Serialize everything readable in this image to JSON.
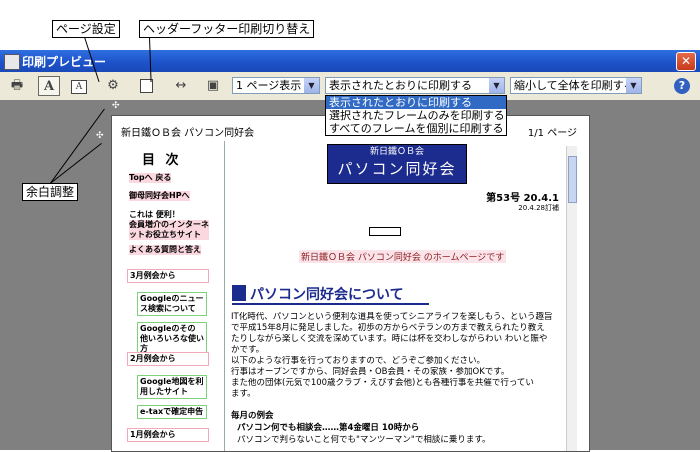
{
  "callouts": {
    "page_setup": "ページ設定",
    "header_footer_toggle": "ヘッダーフッター印刷切り替え",
    "margin_adjust": "余白調整"
  },
  "window": {
    "title": "印刷プレビュー",
    "close_glyph": "✕"
  },
  "toolbar": {
    "print_glyph": "🖶",
    "portrait_glyph": "A",
    "landscape_glyph": "A",
    "page_setup_glyph": "⚙",
    "width_glyph": "↔",
    "full_page_glyph": "▣",
    "page_view": "1 ページ表示",
    "frame_option": "表示されたとおりに印刷する",
    "shrink_option": "縮小して全体を印刷する",
    "help_glyph": "?",
    "dropdown_arrow": "▼"
  },
  "frame_options": [
    "表示されたとおりに印刷する",
    "選択されたフレームのみを印刷する",
    "すべてのフレームを個別に印刷する"
  ],
  "page": {
    "header_left": "新日鐵ＯＢ会 パソコン同好会",
    "header_right": "1/1 ページ",
    "toc_title": "目 次",
    "nav": {
      "top": "Topへ 戻る",
      "hp": "御母同好会HPへ",
      "useful": "これは 便利！",
      "intro": "会員増介のインターネットお役立ちサイト",
      "faq": "よくある質問と答え",
      "march": "3月例会から",
      "news": "Googleのニュース検索について",
      "other": "Googleのその 他いろいろな使い方",
      "feb": "2月例会から",
      "maps": "Google地図を利用したサイト",
      "etax": "e-taxで確定申告",
      "jan": "1月例会から"
    },
    "banner_line1": "新日鐵ＯＢ会",
    "banner_line2": "パソコン同好会",
    "issue": "第53号 20.4.1",
    "issue_date": "20.4.28訂補",
    "home_link": "新日鐵ＯＢ会 パソコン同好会 のホームページです",
    "heading": "パソコン同好会について",
    "body": [
      "IT化時代、パソコンという便利な道具を使ってシニアライフを楽しもう、という趣旨",
      "で平成15年8月に発足しました。初歩の方からベテランの方まで教えられたり教え",
      "たりしながら楽しく交流を深めています。時には杯を交わしながらわい わいと賑や",
      "かです。",
      "以下のような行事を行っておりますので、どうぞご参加ください。",
      "行事はオープンですから、同好会員・OB会員・その家族・参加OKです。",
      "また他の団体(元気で100歳クラブ・えびす会他)とも各種行事を共催で行ってい",
      "ます。"
    ],
    "event_heading": "毎月の例会",
    "event_line1": "パソコン何でも相談会……第4金曜日 10時から",
    "event_line2": "パソコンで判らないこと何でも\"マンツーマン\"で相談に乗ります。"
  }
}
